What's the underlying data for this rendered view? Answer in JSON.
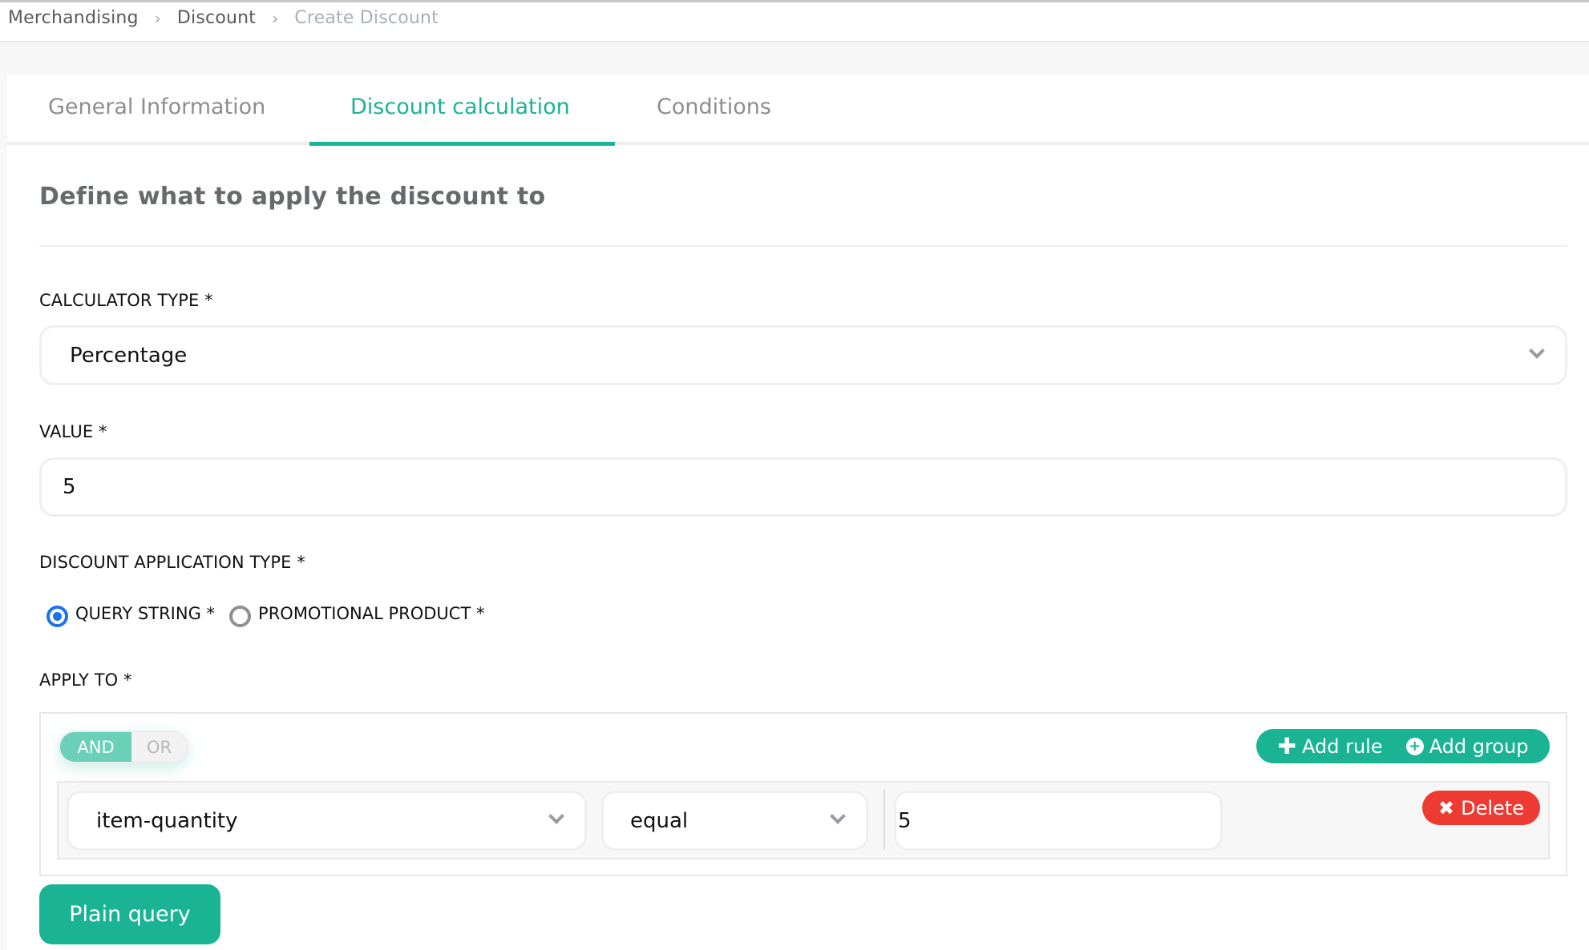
{
  "breadcrumb": {
    "items": [
      "Merchandising",
      "Discount"
    ],
    "current": "Create Discount",
    "separator": ">"
  },
  "tabs": [
    {
      "label": "General Information",
      "active": false
    },
    {
      "label": "Discount calculation",
      "active": true
    },
    {
      "label": "Conditions",
      "active": false
    }
  ],
  "section": {
    "title": "Define what to apply the discount to"
  },
  "form": {
    "calculator_type": {
      "label": "CALCULATOR TYPE *",
      "value": "Percentage"
    },
    "value": {
      "label": "VALUE *",
      "value": "5"
    },
    "application_type": {
      "label": "DISCOUNT APPLICATION TYPE *",
      "options": [
        {
          "label": "QUERY STRING *",
          "checked": true
        },
        {
          "label": "PROMOTIONAL PRODUCT *",
          "checked": false
        }
      ]
    },
    "apply_to": {
      "label": "APPLY TO *"
    }
  },
  "query_builder": {
    "combinator": {
      "and_label": "AND",
      "or_label": "OR",
      "selected": "AND"
    },
    "add_rule_label": "Add rule",
    "add_group_label": "Add group",
    "rules": [
      {
        "field": "item-quantity",
        "operator": "equal",
        "value": "5",
        "delete_label": "Delete"
      }
    ]
  },
  "plain_query_label": "Plain query",
  "colors": {
    "accent": "#1ab394",
    "accent_light": "#6ad0b8",
    "danger": "#ed3b33",
    "radio_checked": "#1a73e8"
  },
  "icons": {
    "breadcrumb_separator": "chevron-right-icon",
    "select_arrow": "chevron-down-icon",
    "add_rule": "plus-icon",
    "add_group": "plus-circle-icon",
    "delete": "x-icon"
  }
}
